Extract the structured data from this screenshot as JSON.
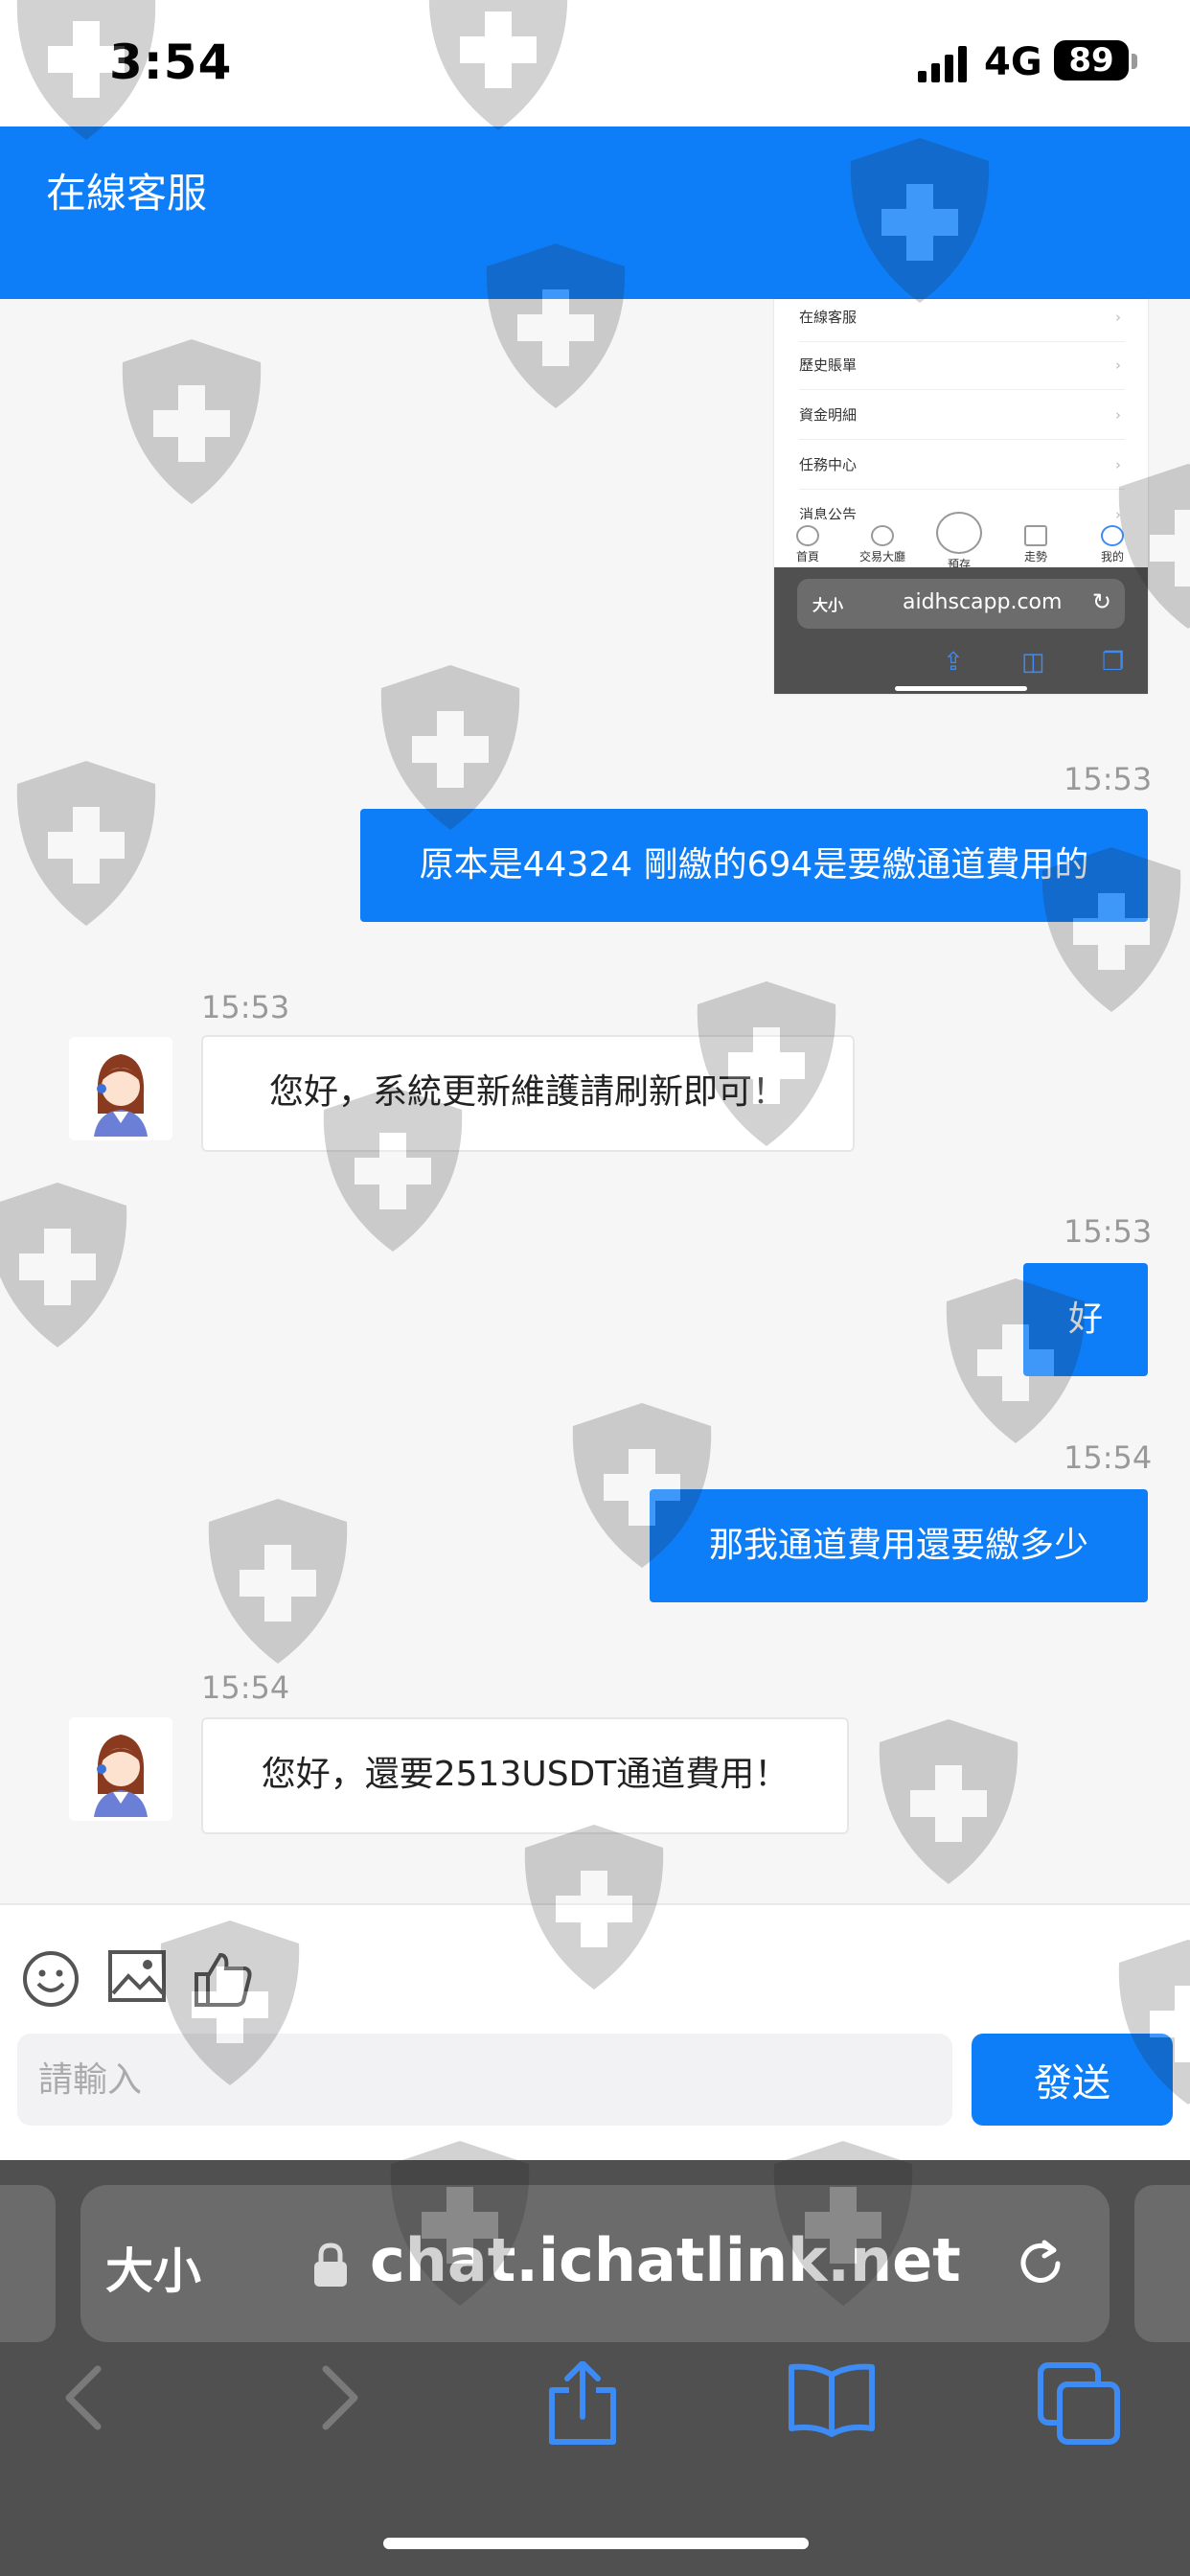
{
  "status_bar": {
    "time": "3:54",
    "network": "4G",
    "battery": "89"
  },
  "header": {
    "title": "在線客服"
  },
  "embedded_screenshot": {
    "menu_items": [
      "在線客服",
      "歷史賬單",
      "資金明細",
      "任務中心",
      "消息公告"
    ],
    "nav_items": [
      "首頁",
      "交易大廳",
      "預存",
      "走勢",
      "我的"
    ],
    "url_size_label": "大小",
    "url_domain": "aidhscapp.com"
  },
  "messages": [
    {
      "direction": "out",
      "time": "15:53",
      "text": "原本是44324 剛繳的694是要繳通道費用的"
    },
    {
      "direction": "in",
      "time": "15:53",
      "text": "您好，系統更新維護請刷新即可！"
    },
    {
      "direction": "out",
      "time": "15:53",
      "text": "好"
    },
    {
      "direction": "out",
      "time": "15:54",
      "text": "那我通道費用還要繳多少"
    },
    {
      "direction": "in",
      "time": "15:54",
      "text": "您好，還要2513USDT通道費用！"
    }
  ],
  "composer": {
    "placeholder": "請輸入",
    "send_label": "發送"
  },
  "browser": {
    "size_label": "大小",
    "domain": "chat.ichatlink.net"
  },
  "colors": {
    "accent": "#0e7ef8",
    "toolbar_bg": "#505050"
  }
}
